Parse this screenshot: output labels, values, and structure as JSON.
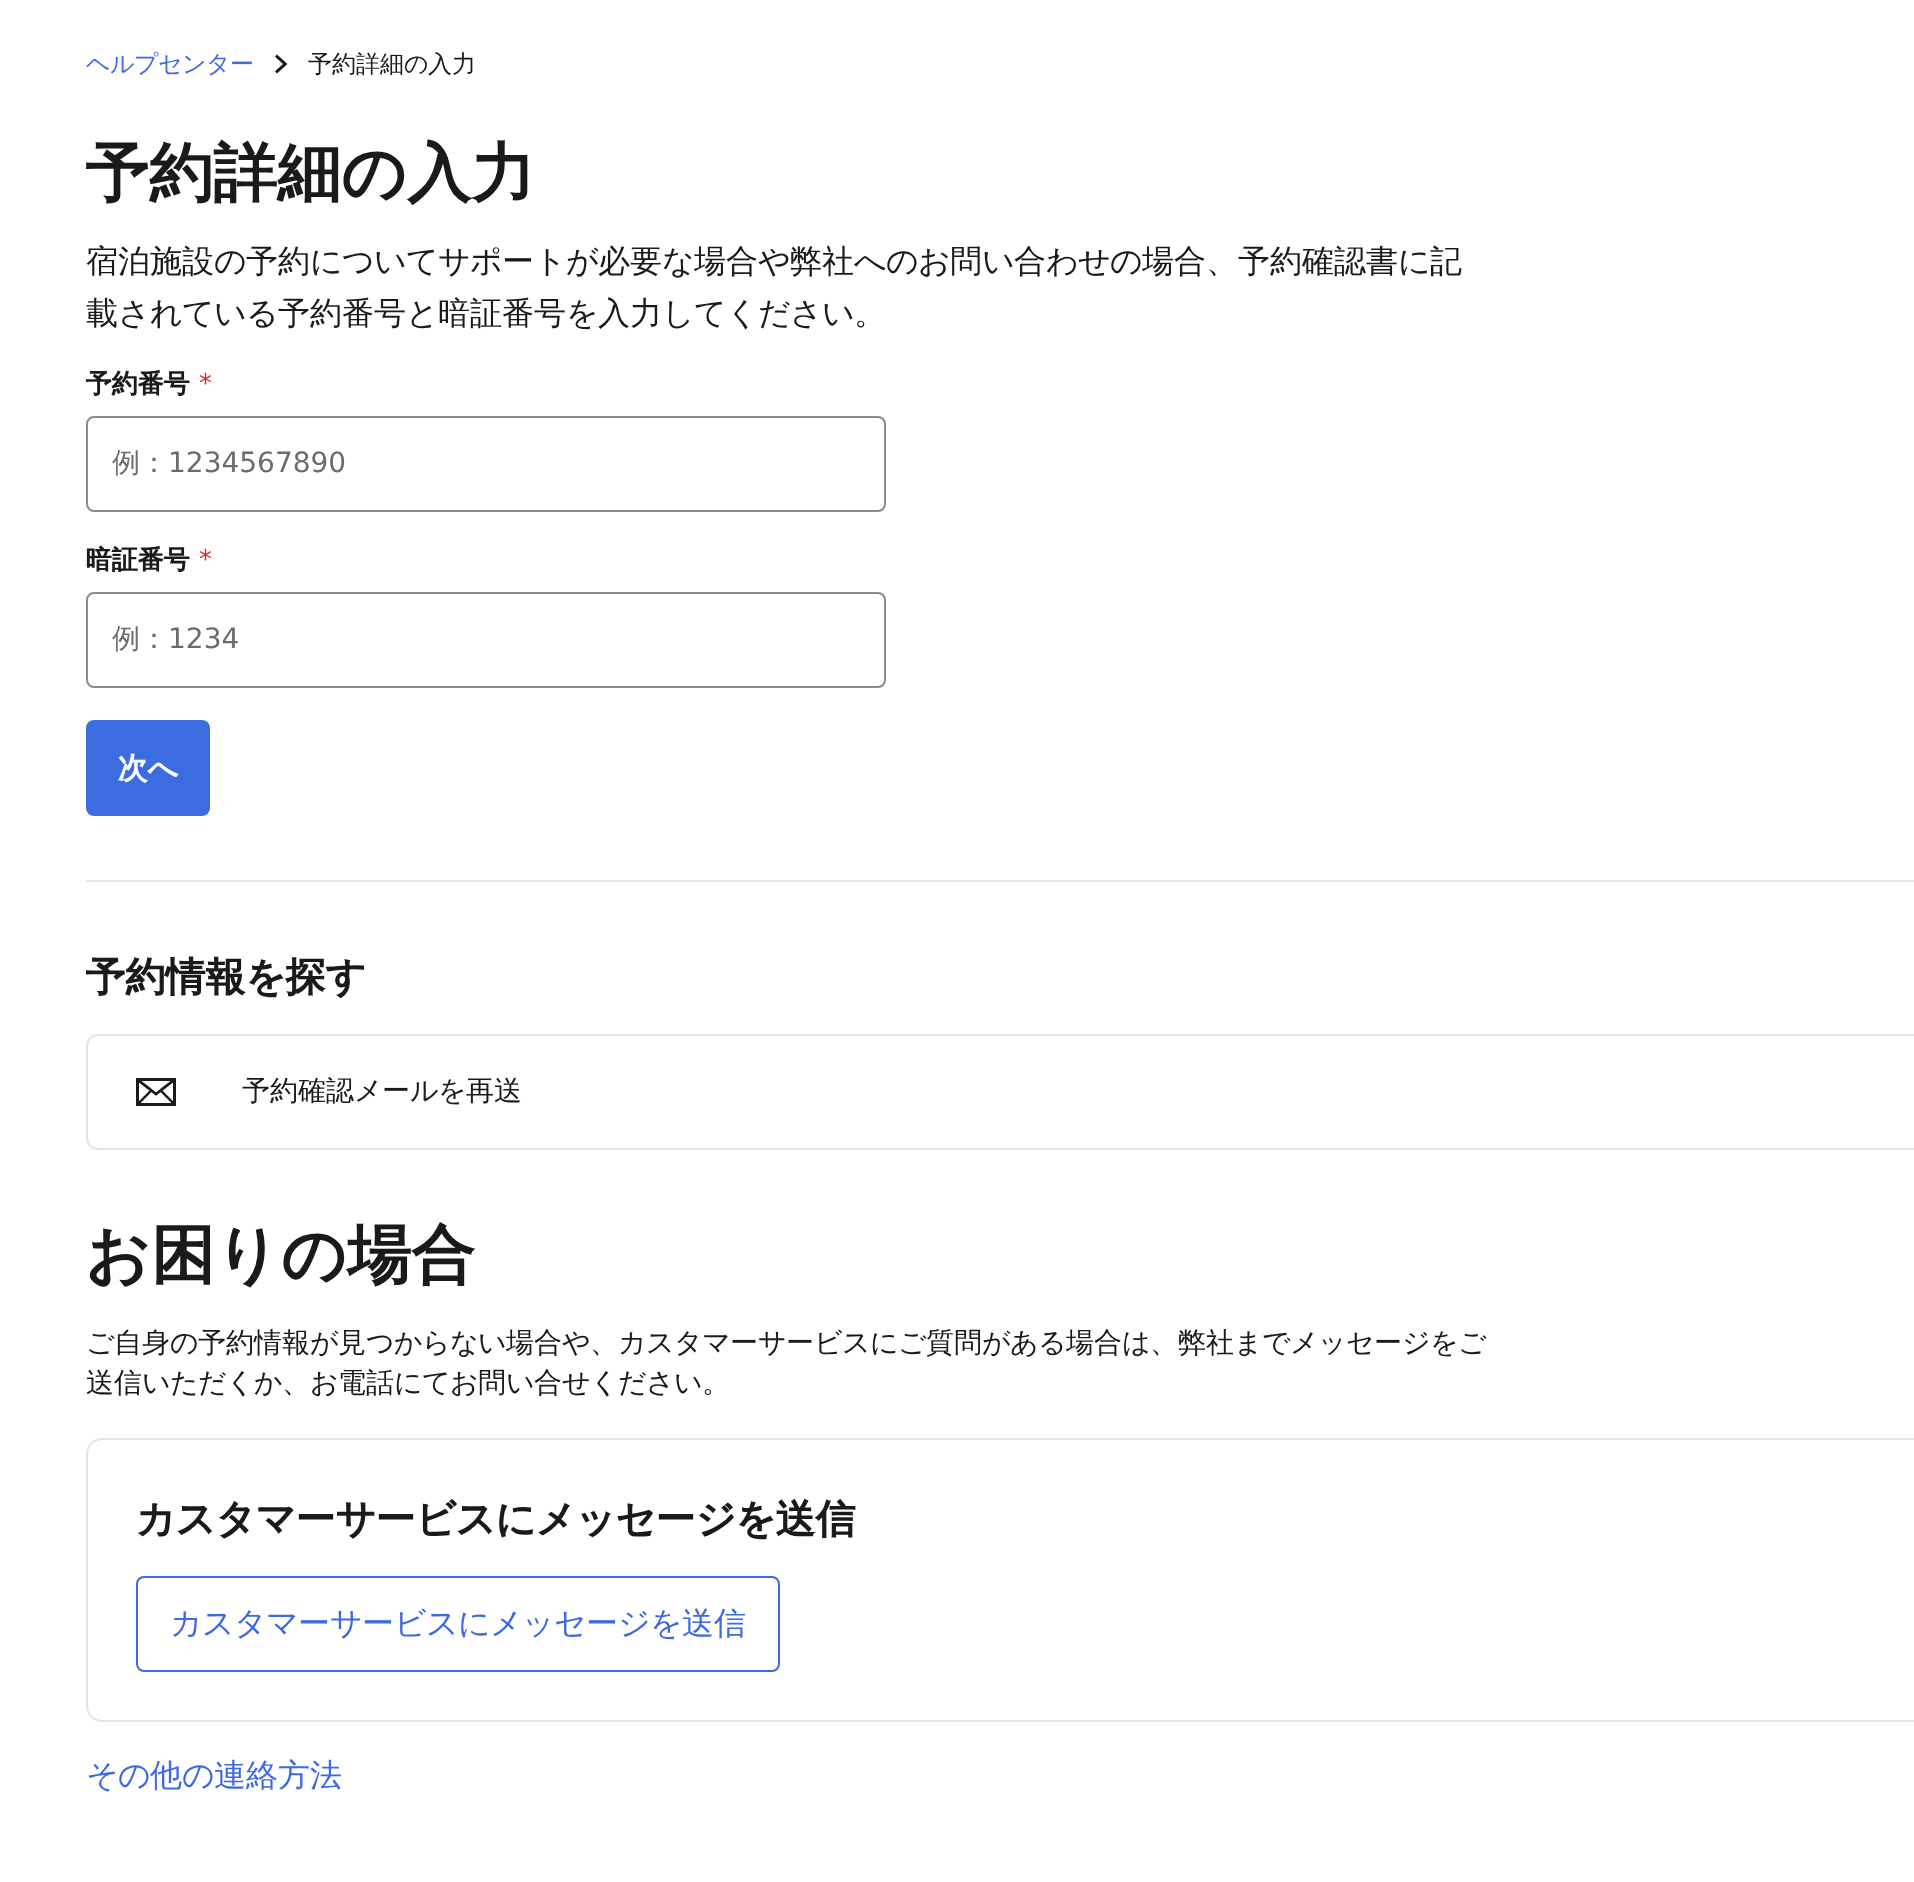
{
  "breadcrumb": [
    {
      "label": "ヘルプセンター",
      "kind": "link"
    },
    {
      "label": "予約詳細の入力",
      "kind": "current"
    }
  ],
  "title": "予約詳細の入力",
  "intro": "宿泊施設の予約についてサポートが必要な場合や弊社へのお問い合わせの場合、予約確認書に記載されている予約番号と暗証番号を入力してください。",
  "form": {
    "fields": [
      {
        "label": "予約番号",
        "required_mark": "*",
        "placeholder": "例：1234567890"
      },
      {
        "label": "暗証番号",
        "required_mark": "*",
        "placeholder": "例：1234"
      }
    ],
    "submit": "次へ"
  },
  "find_section": {
    "heading": "予約情報を探す",
    "items": [
      {
        "kind": "mail",
        "label": "予約確認メールを再送"
      }
    ]
  },
  "help_section": {
    "heading": "お困りの場合",
    "text": "ご自身の予約情報が見つからない場合や、カスタマーサービスにご質問がある場合は、弊社までメッセージをご送信いただくか、お電話にてお問い合せください。",
    "card": {
      "heading": "カスタマーサービスにメッセージを送信",
      "button": "カスタマーサービスにメッセージを送信"
    },
    "link": "その他の連絡方法"
  }
}
